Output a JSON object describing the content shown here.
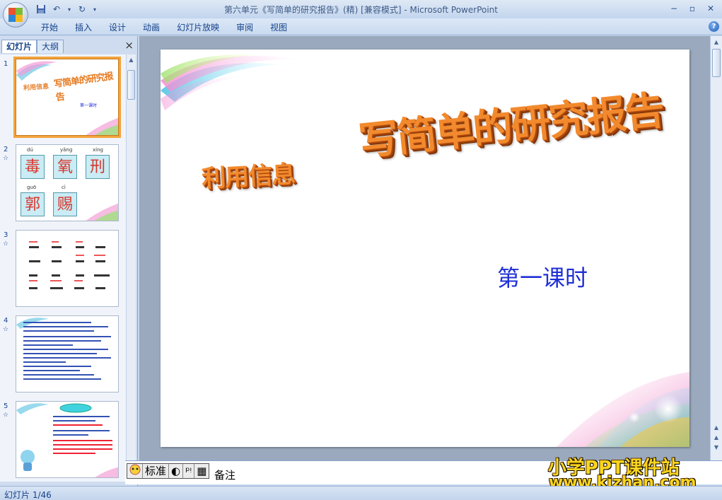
{
  "window": {
    "title": "第六单元《写简单的研究报告》(精) [兼容模式] - Microsoft PowerPoint",
    "controls": [
      "−",
      "▫",
      "✕"
    ]
  },
  "qat": {
    "save_icon": "save-icon",
    "undo_icon": "undo-icon",
    "redo_icon": "redo-icon",
    "more_icon": "customize-icon"
  },
  "ribbon": {
    "tabs": [
      "开始",
      "插入",
      "设计",
      "动画",
      "幻灯片放映",
      "审阅",
      "视图"
    ],
    "help": "?"
  },
  "left_pane": {
    "tab_slides": "幻灯片",
    "tab_outline": "大纲",
    "close": "×",
    "thumbnails": [
      {
        "num": "1",
        "anim": ""
      },
      {
        "num": "2",
        "anim": "☆"
      },
      {
        "num": "3",
        "anim": "☆"
      },
      {
        "num": "4",
        "anim": "☆"
      },
      {
        "num": "5",
        "anim": "☆"
      }
    ],
    "thumb1": {
      "left": "利用信息",
      "right": "写简单的研究报告",
      "lesson": "第一课时"
    },
    "thumb2": {
      "pinyin": [
        "dú",
        "yǎng",
        "xíng",
        "guō",
        "cì"
      ],
      "chars": [
        "毒",
        "氧",
        "刑",
        "郭",
        "赐"
      ]
    }
  },
  "slide": {
    "title_left": "利用信息",
    "title_main": "写简单的研究报告",
    "lesson": "第一课时"
  },
  "notes": {
    "tools": [
      "标准",
      "◐",
      "ᵖᵎ",
      "▦"
    ],
    "label": "备注"
  },
  "watermark": {
    "line1": "小学PPT课件站",
    "line2": "www.kjzhan.com"
  },
  "status": {
    "slide_counter": "幻灯片 1/46"
  },
  "colors": {
    "title_orange": "#f28a2d",
    "lesson_blue": "#1e2fd6",
    "selection": "#f3a33c"
  }
}
